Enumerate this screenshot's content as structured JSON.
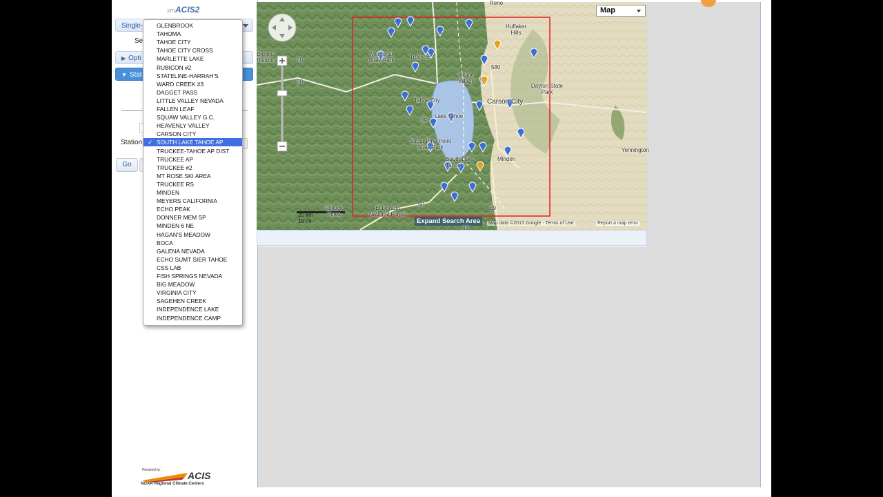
{
  "app": {
    "title_prefix": "xm",
    "title": "ACIS2"
  },
  "sidebar": {
    "single_label": "Single-",
    "sel_label": "Se",
    "options_label": "Opti",
    "station_section_label": "Stat",
    "station_field_label": "Station",
    "go_label": "Go"
  },
  "dropdown": {
    "items": [
      "GLENBROOK",
      "TAHOMA",
      "TAHOE CITY",
      "TAHOE CITY CROSS",
      "MARLETTE LAKE",
      "RUBICON #2",
      "STATELINE-HARRAH'S",
      "WARD CREEK #3",
      "DAGGET PASS",
      "LITTLE VALLEY NEVADA",
      "FALLEN LEAF",
      "SQUAW VALLEY G.C.",
      "HEAVENLY VALLEY",
      "CARSON CITY",
      "SOUTH LAKE TAHOE AP",
      "TRUCKEE-TAHOE AP DIST",
      "TRUCKEE AP",
      "TRUCKEE #2",
      "MT ROSE SKI AREA",
      "TRUCKEE RS",
      "MINDEN",
      "MEYERS CALIFORNIA",
      "ECHO PEAK",
      "DONNER MEM SP",
      "MINDEN 6 NE",
      "HAGAN'S MEADOW",
      "BOCA",
      "GALENA NEVADA",
      "ECHO SUMT SIER TAHOE",
      "CSS LAB",
      "FISH SPRINGS NEVADA",
      "BIG MEADOW",
      "VIRGINIA CITY",
      "SAGEHEN CREEK",
      "INDEPENDENCE LAKE",
      "INDEPENDENCE CAMP"
    ],
    "selected_index": 14,
    "check_glyph": "✓"
  },
  "map": {
    "type_label": "Map",
    "expand_label": "Expand Search Area",
    "map_data_text": "Map data ©2013 Google - Terms of Use",
    "report_error_text": "Report a map error",
    "scale_km": "20 km",
    "scale_mi": "10 mi",
    "labels": {
      "reno": "Reno",
      "huffaker": "Huffaker Hills",
      "dayton": "Dayton State Park",
      "incline": "Incline Village",
      "carson": "Carson City",
      "tahoe_city": "Tahoe City",
      "lake_tahoe": "Lake Tahoe",
      "sugar_pine": "Sugar Pine Point State Park",
      "south_lake": "South Lake Tahoe",
      "minden": "Minden",
      "yennington": "Yennington",
      "pollock": "Pollock Pines",
      "eldorado": "El Dorado National Forest",
      "truckee": "Truckee",
      "memorial": "Memorial State Park",
      "diggins": "Diggins Historic",
      "r20": "20",
      "r80": "80",
      "r89": "89",
      "r580": "580",
      "r50": "50",
      "r89b": "89",
      "r88": "88"
    }
  },
  "footer": {
    "powered_by": "Powered by",
    "logo": "ACIS",
    "org": "NOAA Regional Climate Centers"
  },
  "colors": {
    "selection": "#3f6fe0",
    "accent": "#4a90d9",
    "bbox": "#e02020"
  }
}
